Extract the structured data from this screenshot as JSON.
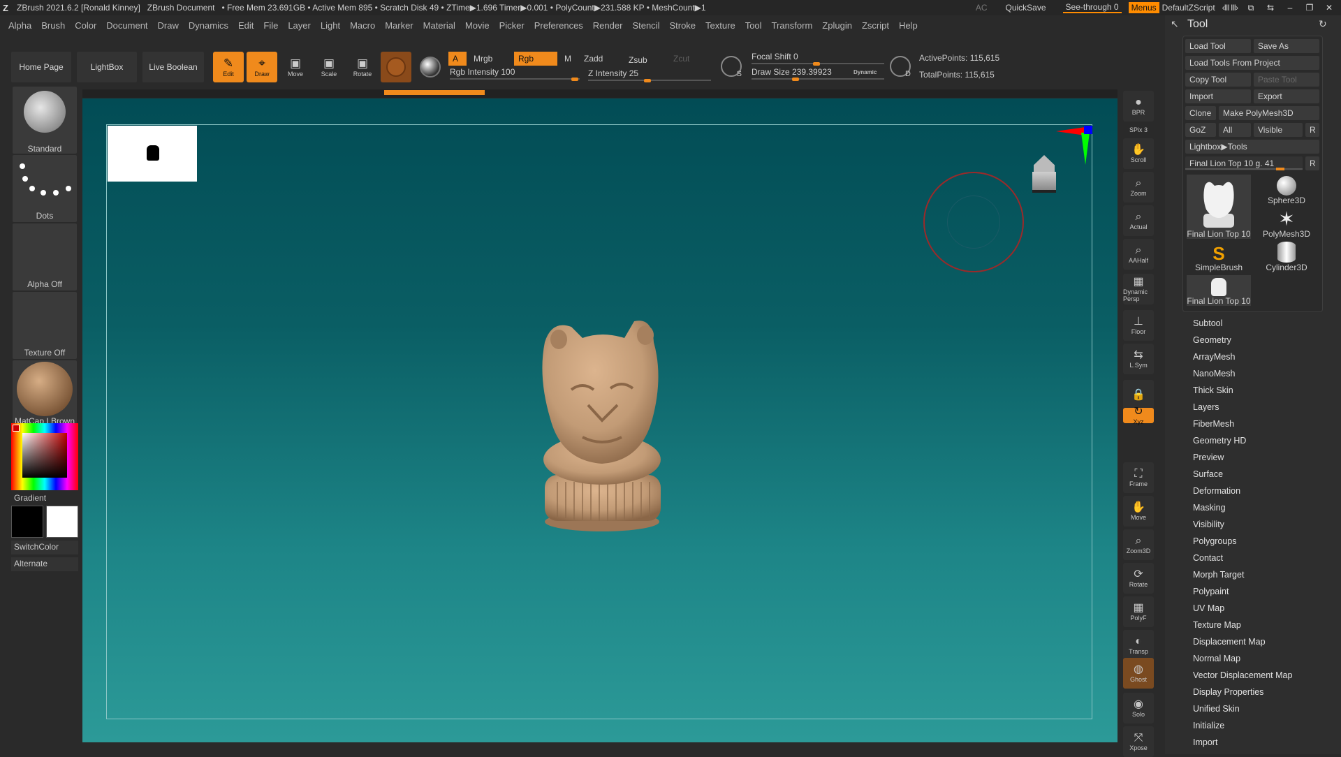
{
  "titlebar": {
    "app": "ZBrush 2021.6.2 [Ronald Kinney]",
    "doc": "ZBrush Document",
    "stats": "• Free Mem 23.691GB • Active Mem 895 • Scratch Disk 49 •  ZTime▶1.696 Timer▶0.001 • PolyCount▶231.588 KP  • MeshCount▶1",
    "ac": "AC",
    "quicksave": "QuickSave",
    "see_through": "See-through  0",
    "menus": "Menus",
    "script": "DefaultZScript"
  },
  "menu": [
    "Alpha",
    "Brush",
    "Color",
    "Document",
    "Draw",
    "Dynamics",
    "Edit",
    "File",
    "Layer",
    "Light",
    "Macro",
    "Marker",
    "Material",
    "Movie",
    "Picker",
    "Preferences",
    "Render",
    "Stencil",
    "Stroke",
    "Texture",
    "Tool",
    "Transform",
    "Zplugin",
    "Zscript",
    "Help"
  ],
  "toolbar": {
    "home": "Home Page",
    "lightbox": "LightBox",
    "live_boolean": "Live Boolean",
    "edit": "Edit",
    "draw": "Draw",
    "move": "Move",
    "scale": "Scale",
    "rotate": "Rotate",
    "a": "A",
    "mrgb": "Mrgb",
    "rgb": "Rgb",
    "m": "M",
    "zadd": "Zadd",
    "zsub": "Zsub",
    "zcut": "Zcut",
    "rgb_intensity": "Rgb Intensity 100",
    "z_intensity": "Z Intensity 25",
    "focal_shift": "Focal Shift 0",
    "draw_size": "Draw Size 239.39923",
    "dynamic": "Dynamic",
    "active_points": "ActivePoints: 115,615",
    "total_points": "TotalPoints: 115,615",
    "s_label": "S",
    "d_label": "D"
  },
  "left": {
    "brush": "Standard",
    "stroke": "Dots",
    "alpha": "Alpha Off",
    "texture": "Texture Off",
    "material": "MatCap LBrown",
    "gradient": "Gradient",
    "switchcolor": "SwitchColor",
    "alternate": "Alternate"
  },
  "right_shelf": [
    {
      "label": "BPR",
      "icon": "sphere-icon"
    },
    {
      "label": "SPix 3",
      "icon": ""
    },
    {
      "label": "Scroll",
      "icon": "hand-icon"
    },
    {
      "label": "Zoom",
      "icon": "magnifier-icon"
    },
    {
      "label": "Actual",
      "icon": "magnifier-icon"
    },
    {
      "label": "AAHalf",
      "icon": "magnifier-icon"
    },
    {
      "label": "Dynamic Persp",
      "icon": "grid-icon"
    },
    {
      "label": "Floor",
      "icon": "floor-icon"
    },
    {
      "label": "L.Sym",
      "icon": "arrows-icon"
    },
    {
      "label": "",
      "icon": "lock-icon"
    },
    {
      "label": "Xyz",
      "icon": "xyz-icon"
    },
    {
      "label": "Frame",
      "icon": "frame-icon"
    },
    {
      "label": "Move",
      "icon": "hand-icon"
    },
    {
      "label": "Zoom3D",
      "icon": "magnifier-icon"
    },
    {
      "label": "Rotate",
      "icon": "rotate-icon"
    },
    {
      "label": "PolyF",
      "icon": "grid-icon"
    },
    {
      "label": "Transp",
      "icon": "transp-icon"
    },
    {
      "label": "Ghost",
      "icon": "ghost-icon"
    },
    {
      "label": "Solo",
      "icon": "solo-icon"
    },
    {
      "label": "Xpose",
      "icon": "xpose-icon"
    }
  ],
  "palette": {
    "title": "Tool",
    "load_tool": "Load Tool",
    "save_as": "Save As",
    "load_from_project": "Load Tools From Project",
    "copy_tool": "Copy Tool",
    "paste_tool": "Paste Tool",
    "import": "Import",
    "export": "Export",
    "clone": "Clone",
    "make_polymesh": "Make PolyMesh3D",
    "goz": "GoZ",
    "all": "All",
    "visible": "Visible",
    "r": "R",
    "lightbox_tools": "Lightbox▶Tools",
    "current_tool": "Final Lion Top 10 g. 41",
    "thumbs": [
      "Final Lion Top 10",
      "Sphere3D",
      "SimpleBrush",
      "PolyMesh3D",
      "Cylinder3D",
      "Final Lion Top 10"
    ],
    "subpalettes": [
      "Subtool",
      "Geometry",
      "ArrayMesh",
      "NanoMesh",
      "Thick Skin",
      "Layers",
      "FiberMesh",
      "Geometry HD",
      "Preview",
      "Surface",
      "Deformation",
      "Masking",
      "Visibility",
      "Polygroups",
      "Contact",
      "Morph Target",
      "Polypaint",
      "UV Map",
      "Texture Map",
      "Displacement Map",
      "Normal Map",
      "Vector Displacement Map",
      "Display Properties",
      "Unified Skin",
      "Initialize",
      "Import"
    ]
  },
  "colors": {
    "accent": "#f08a1c",
    "bg": "#2a2a2a",
    "viewport_top": "#024c55",
    "viewport_bottom": "#2c9a98",
    "model": "#c8a37f"
  }
}
